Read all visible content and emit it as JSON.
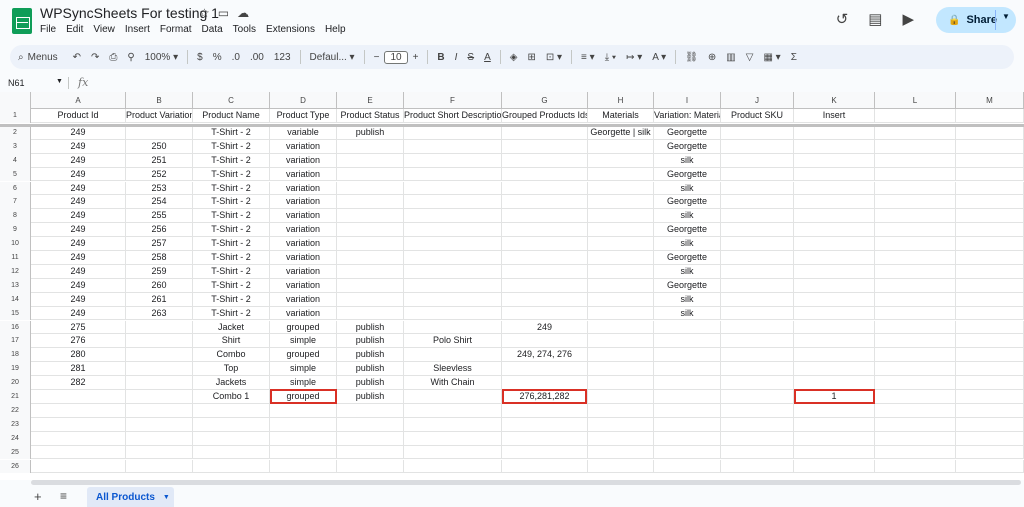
{
  "window": {
    "title": "WPSyncSheets For testing 1",
    "menus": [
      "File",
      "Edit",
      "View",
      "Insert",
      "Format",
      "Data",
      "Tools",
      "Extensions",
      "Help"
    ],
    "share_label": "Share"
  },
  "toolbar": {
    "menus_label": "Menus",
    "zoom": "100%",
    "currency": "$",
    "percent": "%",
    "dec_decrease": ".0",
    "dec_increase": ".00",
    "number_format": "123",
    "font": "Defaul...",
    "font_size": "10"
  },
  "formula_bar": {
    "cell_ref": "N61",
    "fx": "fx"
  },
  "columns": [
    "A",
    "B",
    "C",
    "D",
    "E",
    "F",
    "G",
    "H",
    "I",
    "J",
    "K",
    "L",
    "M"
  ],
  "rows": [
    [
      "1",
      "Product Id",
      "Product Variation I",
      "Product Name",
      "Product Type",
      "Product Status",
      "Product Short Description",
      "Grouped Products Ids",
      "Materials",
      "Variation: Material",
      "Product SKU",
      "Insert",
      "",
      ""
    ],
    [
      "2",
      "249",
      "",
      "T-Shirt - 2",
      "variable",
      "publish",
      "",
      "",
      "Georgette | silk",
      "Georgette",
      "",
      "",
      "",
      ""
    ],
    [
      "3",
      "249",
      "250",
      "T-Shirt - 2",
      "variation",
      "",
      "",
      "",
      "",
      "Georgette",
      "",
      "",
      "",
      ""
    ],
    [
      "4",
      "249",
      "251",
      "T-Shirt - 2",
      "variation",
      "",
      "",
      "",
      "",
      "silk",
      "",
      "",
      "",
      ""
    ],
    [
      "5",
      "249",
      "252",
      "T-Shirt - 2",
      "variation",
      "",
      "",
      "",
      "",
      "Georgette",
      "",
      "",
      "",
      ""
    ],
    [
      "6",
      "249",
      "253",
      "T-Shirt - 2",
      "variation",
      "",
      "",
      "",
      "",
      "silk",
      "",
      "",
      "",
      ""
    ],
    [
      "7",
      "249",
      "254",
      "T-Shirt - 2",
      "variation",
      "",
      "",
      "",
      "",
      "Georgette",
      "",
      "",
      "",
      ""
    ],
    [
      "8",
      "249",
      "255",
      "T-Shirt - 2",
      "variation",
      "",
      "",
      "",
      "",
      "silk",
      "",
      "",
      "",
      ""
    ],
    [
      "9",
      "249",
      "256",
      "T-Shirt - 2",
      "variation",
      "",
      "",
      "",
      "",
      "Georgette",
      "",
      "",
      "",
      ""
    ],
    [
      "10",
      "249",
      "257",
      "T-Shirt - 2",
      "variation",
      "",
      "",
      "",
      "",
      "silk",
      "",
      "",
      "",
      ""
    ],
    [
      "11",
      "249",
      "258",
      "T-Shirt - 2",
      "variation",
      "",
      "",
      "",
      "",
      "Georgette",
      "",
      "",
      "",
      ""
    ],
    [
      "12",
      "249",
      "259",
      "T-Shirt - 2",
      "variation",
      "",
      "",
      "",
      "",
      "silk",
      "",
      "",
      "",
      ""
    ],
    [
      "13",
      "249",
      "260",
      "T-Shirt - 2",
      "variation",
      "",
      "",
      "",
      "",
      "Georgette",
      "",
      "",
      "",
      ""
    ],
    [
      "14",
      "249",
      "261",
      "T-Shirt - 2",
      "variation",
      "",
      "",
      "",
      "",
      "silk",
      "",
      "",
      "",
      ""
    ],
    [
      "15",
      "249",
      "263",
      "T-Shirt - 2",
      "variation",
      "",
      "",
      "",
      "",
      "silk",
      "",
      "",
      "",
      ""
    ],
    [
      "16",
      "275",
      "",
      "Jacket",
      "grouped",
      "publish",
      "",
      "249",
      "",
      "",
      "",
      "",
      "",
      ""
    ],
    [
      "17",
      "276",
      "",
      "Shirt",
      "simple",
      "publish",
      "Polo Shirt",
      "",
      "",
      "",
      "",
      "",
      "",
      ""
    ],
    [
      "18",
      "280",
      "",
      "Combo",
      "grouped",
      "publish",
      "",
      "249, 274, 276",
      "",
      "",
      "",
      "",
      "",
      ""
    ],
    [
      "19",
      "281",
      "",
      "Top",
      "simple",
      "publish",
      "Sleevless",
      "",
      "",
      "",
      "",
      "",
      "",
      ""
    ],
    [
      "20",
      "282",
      "",
      "Jackets",
      "simple",
      "publish",
      "With Chain",
      "",
      "",
      "",
      "",
      "",
      "",
      ""
    ],
    [
      "21",
      "",
      "",
      "Combo 1",
      "grouped",
      "publish",
      "",
      "276,281,282",
      "",
      "",
      "",
      "1",
      "",
      ""
    ],
    [
      "22",
      "",
      "",
      "",
      "",
      "",
      "",
      "",
      "",
      "",
      "",
      "",
      "",
      ""
    ],
    [
      "23",
      "",
      "",
      "",
      "",
      "",
      "",
      "",
      "",
      "",
      "",
      "",
      "",
      ""
    ],
    [
      "24",
      "",
      "",
      "",
      "",
      "",
      "",
      "",
      "",
      "",
      "",
      "",
      "",
      ""
    ],
    [
      "25",
      "",
      "",
      "",
      "",
      "",
      "",
      "",
      "",
      "",
      "",
      "",
      "",
      ""
    ],
    [
      "26",
      "",
      "",
      "",
      "",
      "",
      "",
      "",
      "",
      "",
      "",
      "",
      "",
      ""
    ]
  ],
  "sheet_tabs": [
    {
      "label": "All Products",
      "active": true
    }
  ],
  "colors": {
    "highlight": "#d93025",
    "share_bg": "#c2e7ff",
    "active_tab": "#0b57d0"
  }
}
